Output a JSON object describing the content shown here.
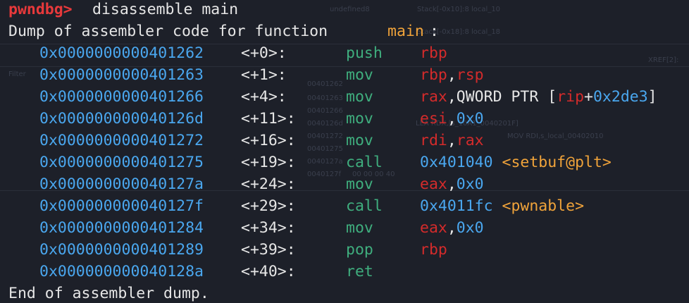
{
  "terminal": {
    "prompt": "pwndbg>",
    "command": "disassemble main",
    "header_prefix": "Dump of assembler code for function ",
    "header_function": "main",
    "header_suffix": ":",
    "footer": "End of assembler dump.",
    "instructions": [
      {
        "address": "0x0000000000401262",
        "offset": "<+0>:",
        "mnemonic": "push",
        "operands": [
          {
            "text": "rbp",
            "color": "red"
          }
        ]
      },
      {
        "address": "0x0000000000401263",
        "offset": "<+1>:",
        "mnemonic": "mov",
        "operands": [
          {
            "text": "rbp",
            "color": "red"
          },
          {
            "text": ",",
            "color": "white"
          },
          {
            "text": "rsp",
            "color": "red"
          }
        ]
      },
      {
        "address": "0x0000000000401266",
        "offset": "<+4>:",
        "mnemonic": "mov",
        "operands": [
          {
            "text": "rax",
            "color": "red"
          },
          {
            "text": ",QWORD PTR [",
            "color": "white"
          },
          {
            "text": "rip",
            "color": "red"
          },
          {
            "text": "+",
            "color": "white"
          },
          {
            "text": "0x2de3",
            "color": "blue"
          },
          {
            "text": "]",
            "color": "white"
          }
        ]
      },
      {
        "address": "0x000000000040126d",
        "offset": "<+11>:",
        "mnemonic": "mov",
        "operands": [
          {
            "text": "esi",
            "color": "red"
          },
          {
            "text": ",",
            "color": "white"
          },
          {
            "text": "0x0",
            "color": "blue"
          }
        ]
      },
      {
        "address": "0x0000000000401272",
        "offset": "<+16>:",
        "mnemonic": "mov",
        "operands": [
          {
            "text": "rdi",
            "color": "red"
          },
          {
            "text": ",",
            "color": "white"
          },
          {
            "text": "rax",
            "color": "red"
          }
        ]
      },
      {
        "address": "0x0000000000401275",
        "offset": "<+19>:",
        "mnemonic": "call",
        "operands": [
          {
            "text": "0x401040",
            "color": "blue"
          },
          {
            "text": " ",
            "color": "white"
          },
          {
            "text": "<setbuf@plt>",
            "color": "orange"
          }
        ]
      },
      {
        "address": "0x000000000040127a",
        "offset": "<+24>:",
        "mnemonic": "mov",
        "operands": [
          {
            "text": "eax",
            "color": "red"
          },
          {
            "text": ",",
            "color": "white"
          },
          {
            "text": "0x0",
            "color": "blue"
          }
        ]
      },
      {
        "address": "0x000000000040127f",
        "offset": "<+29>:",
        "mnemonic": "call",
        "operands": [
          {
            "text": "0x4011fc",
            "color": "blue"
          },
          {
            "text": " ",
            "color": "white"
          },
          {
            "text": "<pwnable>",
            "color": "orange"
          }
        ]
      },
      {
        "address": "0x0000000000401284",
        "offset": "<+34>:",
        "mnemonic": "mov",
        "operands": [
          {
            "text": "eax",
            "color": "red"
          },
          {
            "text": ",",
            "color": "white"
          },
          {
            "text": "0x0",
            "color": "blue"
          }
        ]
      },
      {
        "address": "0x0000000000401289",
        "offset": "<+39>:",
        "mnemonic": "pop",
        "operands": [
          {
            "text": "rbp",
            "color": "red"
          }
        ]
      },
      {
        "address": "0x000000000040128a",
        "offset": "<+40>:",
        "mnemonic": "ret",
        "operands": []
      }
    ]
  },
  "background_window": {
    "texts": [
      "undefined8",
      "Stack[-0x10]:8 local_10",
      "Stack[-0x18]:8 local_18",
      "XREF[2]:",
      "Filter",
      "00401262",
      "00401263",
      "00401266",
      "0040126d",
      "00401272",
      "00401275",
      "0040127a",
      "0040127f",
      "LEA RDX,[s_10A1_0040201F]",
      "MOV RDI,s_local_00402010",
      "00 00 00 40"
    ]
  },
  "colors": {
    "background": "#1d2029",
    "prompt": "#e8393b",
    "text": "#e6e6e6",
    "address": "#4aa7ef",
    "mnemonic": "#3fae7e",
    "register": "#d42b2b",
    "symbol": "#f0a33a"
  }
}
